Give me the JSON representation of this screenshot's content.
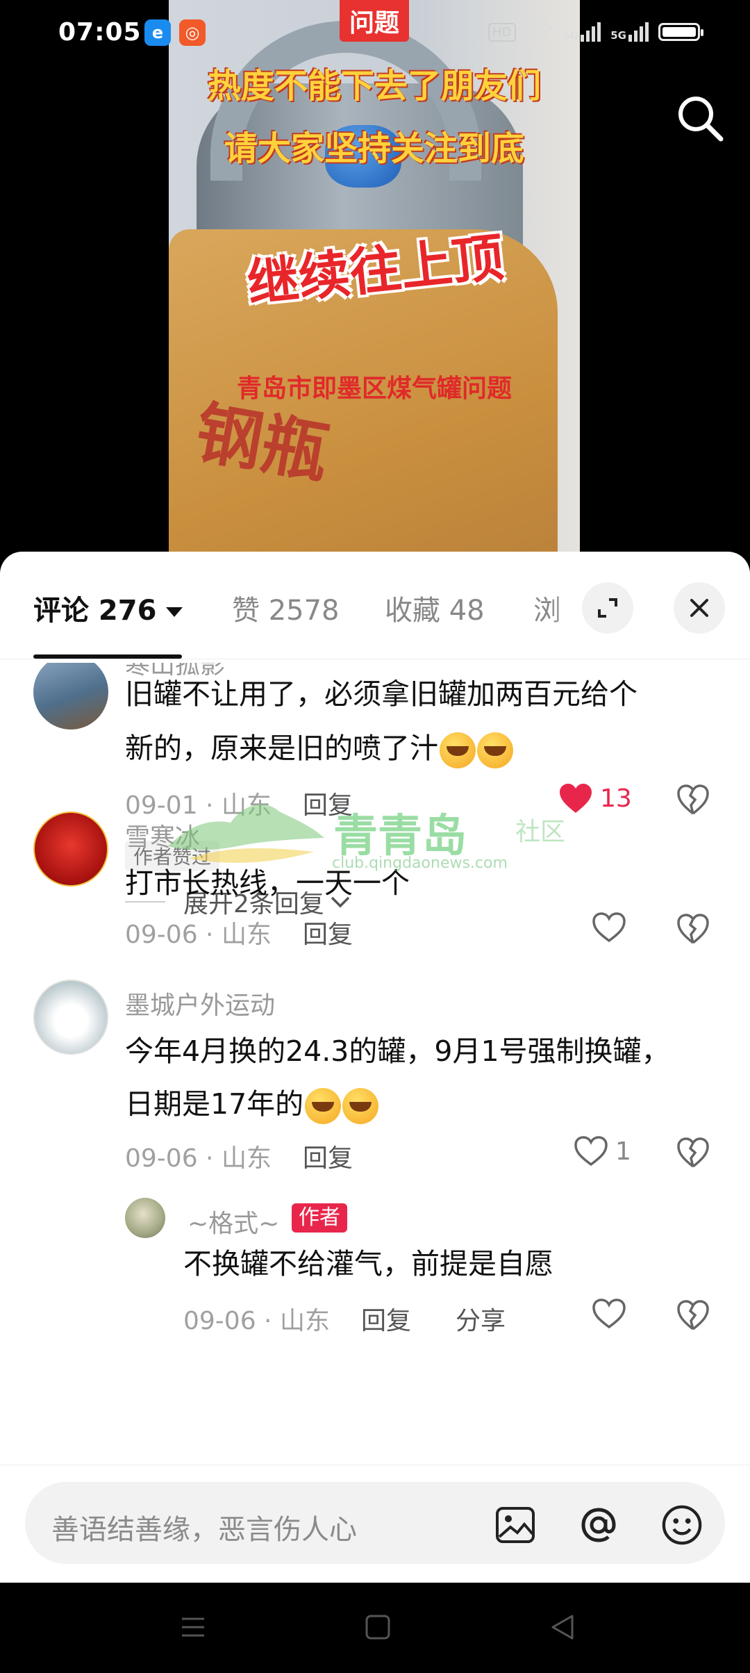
{
  "status_bar": {
    "time": "07:05",
    "hd_label": "HD",
    "signal_1": "5G",
    "signal_2": "5G",
    "battery_level": 1.0
  },
  "video": {
    "overlay_tag": "问题",
    "overlay_line1": "热度不能下去了朋友们",
    "overlay_line2": "请大家坚持关注到底",
    "overlay_big": "继续往上顶",
    "overlay_subtitle": "青岛市即墨区煤气罐问题",
    "bag_text": "钢瓶"
  },
  "tabs": {
    "comments_label": "评论 276",
    "likes_label": "赞 2578",
    "favorites_label": "收藏 48",
    "views_label": "浏"
  },
  "comments": [
    {
      "name": "寒山孤影",
      "text_line1": "旧罐不让用了，必须拿旧罐加两百元给个",
      "text_line2": "新的，原来是旧的喷了汁",
      "meta": "09-01 · 山东",
      "reply_label": "回复",
      "likes": "13",
      "author_liked": "作者赞过",
      "expand_label": "展开2条回复"
    },
    {
      "name": "雪寒冰",
      "text_line1": "打市长热线，一天一个",
      "meta": "09-06 · 山东",
      "reply_label": "回复"
    },
    {
      "name": "墨城户外运动",
      "text_line1": "今年4月换的24.3的罐，9月1号强制换罐，",
      "text_line2": "日期是17年的",
      "meta": "09-06 · 山东",
      "reply_label": "回复",
      "likes": "1"
    }
  ],
  "reply": {
    "name": "~格式~",
    "author_tag": "作者",
    "text": "不换罐不给灌气，前提是自愿",
    "meta": "09-06 · 山东",
    "reply_label": "回复",
    "share_label": "分享"
  },
  "watermark": {
    "title": "青青岛",
    "tag": "社区",
    "url": "club.qingdaonews.com"
  },
  "input": {
    "placeholder": "善语结善缘，恶言伤人心"
  },
  "colors": {
    "accent_like": "#e8264b",
    "author_tag_bg": "#e8264b"
  }
}
